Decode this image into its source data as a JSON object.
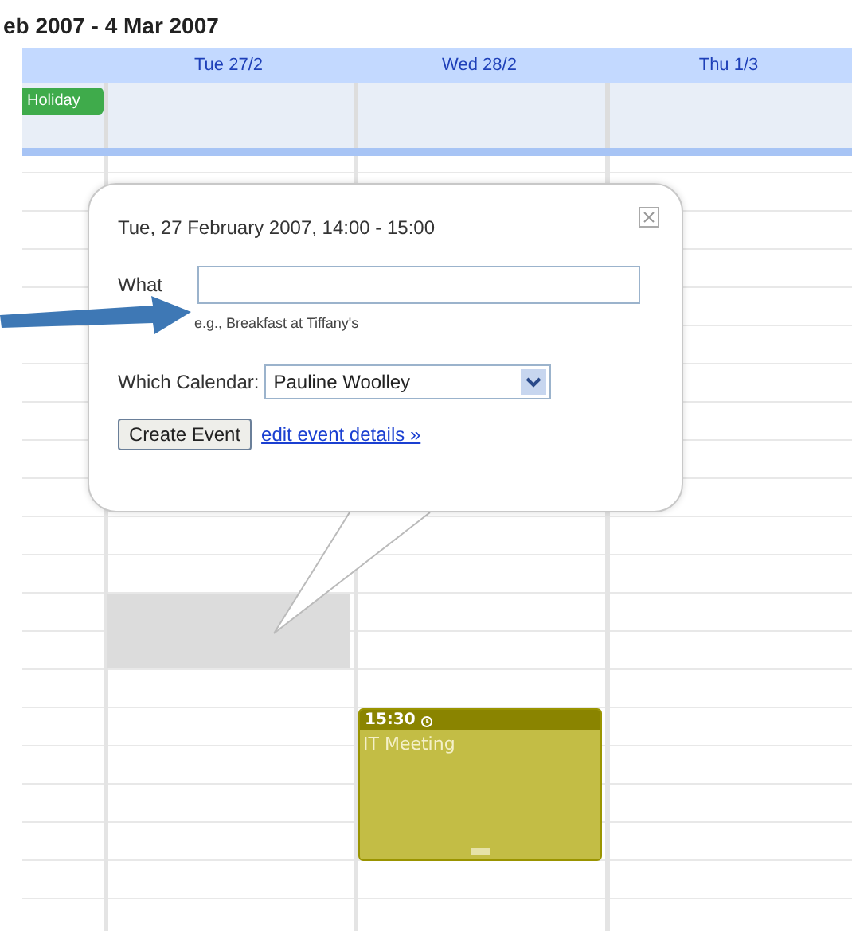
{
  "range_title": "eb 2007 - 4 Mar 2007",
  "columns": [
    {},
    {
      "label": "Tue 27/2"
    },
    {
      "label": "Wed 28/2"
    },
    {
      "label": "Thu 1/3"
    }
  ],
  "all_day_events": [
    {
      "label": "Holiday",
      "color": "#3fab4b"
    }
  ],
  "popup": {
    "heading": "Tue, 27 February 2007, 14:00 - 15:00",
    "what_label": "What",
    "hint": "e.g., Breakfast at Tiffany's",
    "calendar_label": "Which Calendar:",
    "calendar_value": "Pauline Woolley",
    "create_button": "Create Event",
    "edit_link": "edit event details »"
  },
  "events": [
    {
      "time": "15:30",
      "title": "IT Meeting",
      "color": "#c3bd45"
    }
  ]
}
